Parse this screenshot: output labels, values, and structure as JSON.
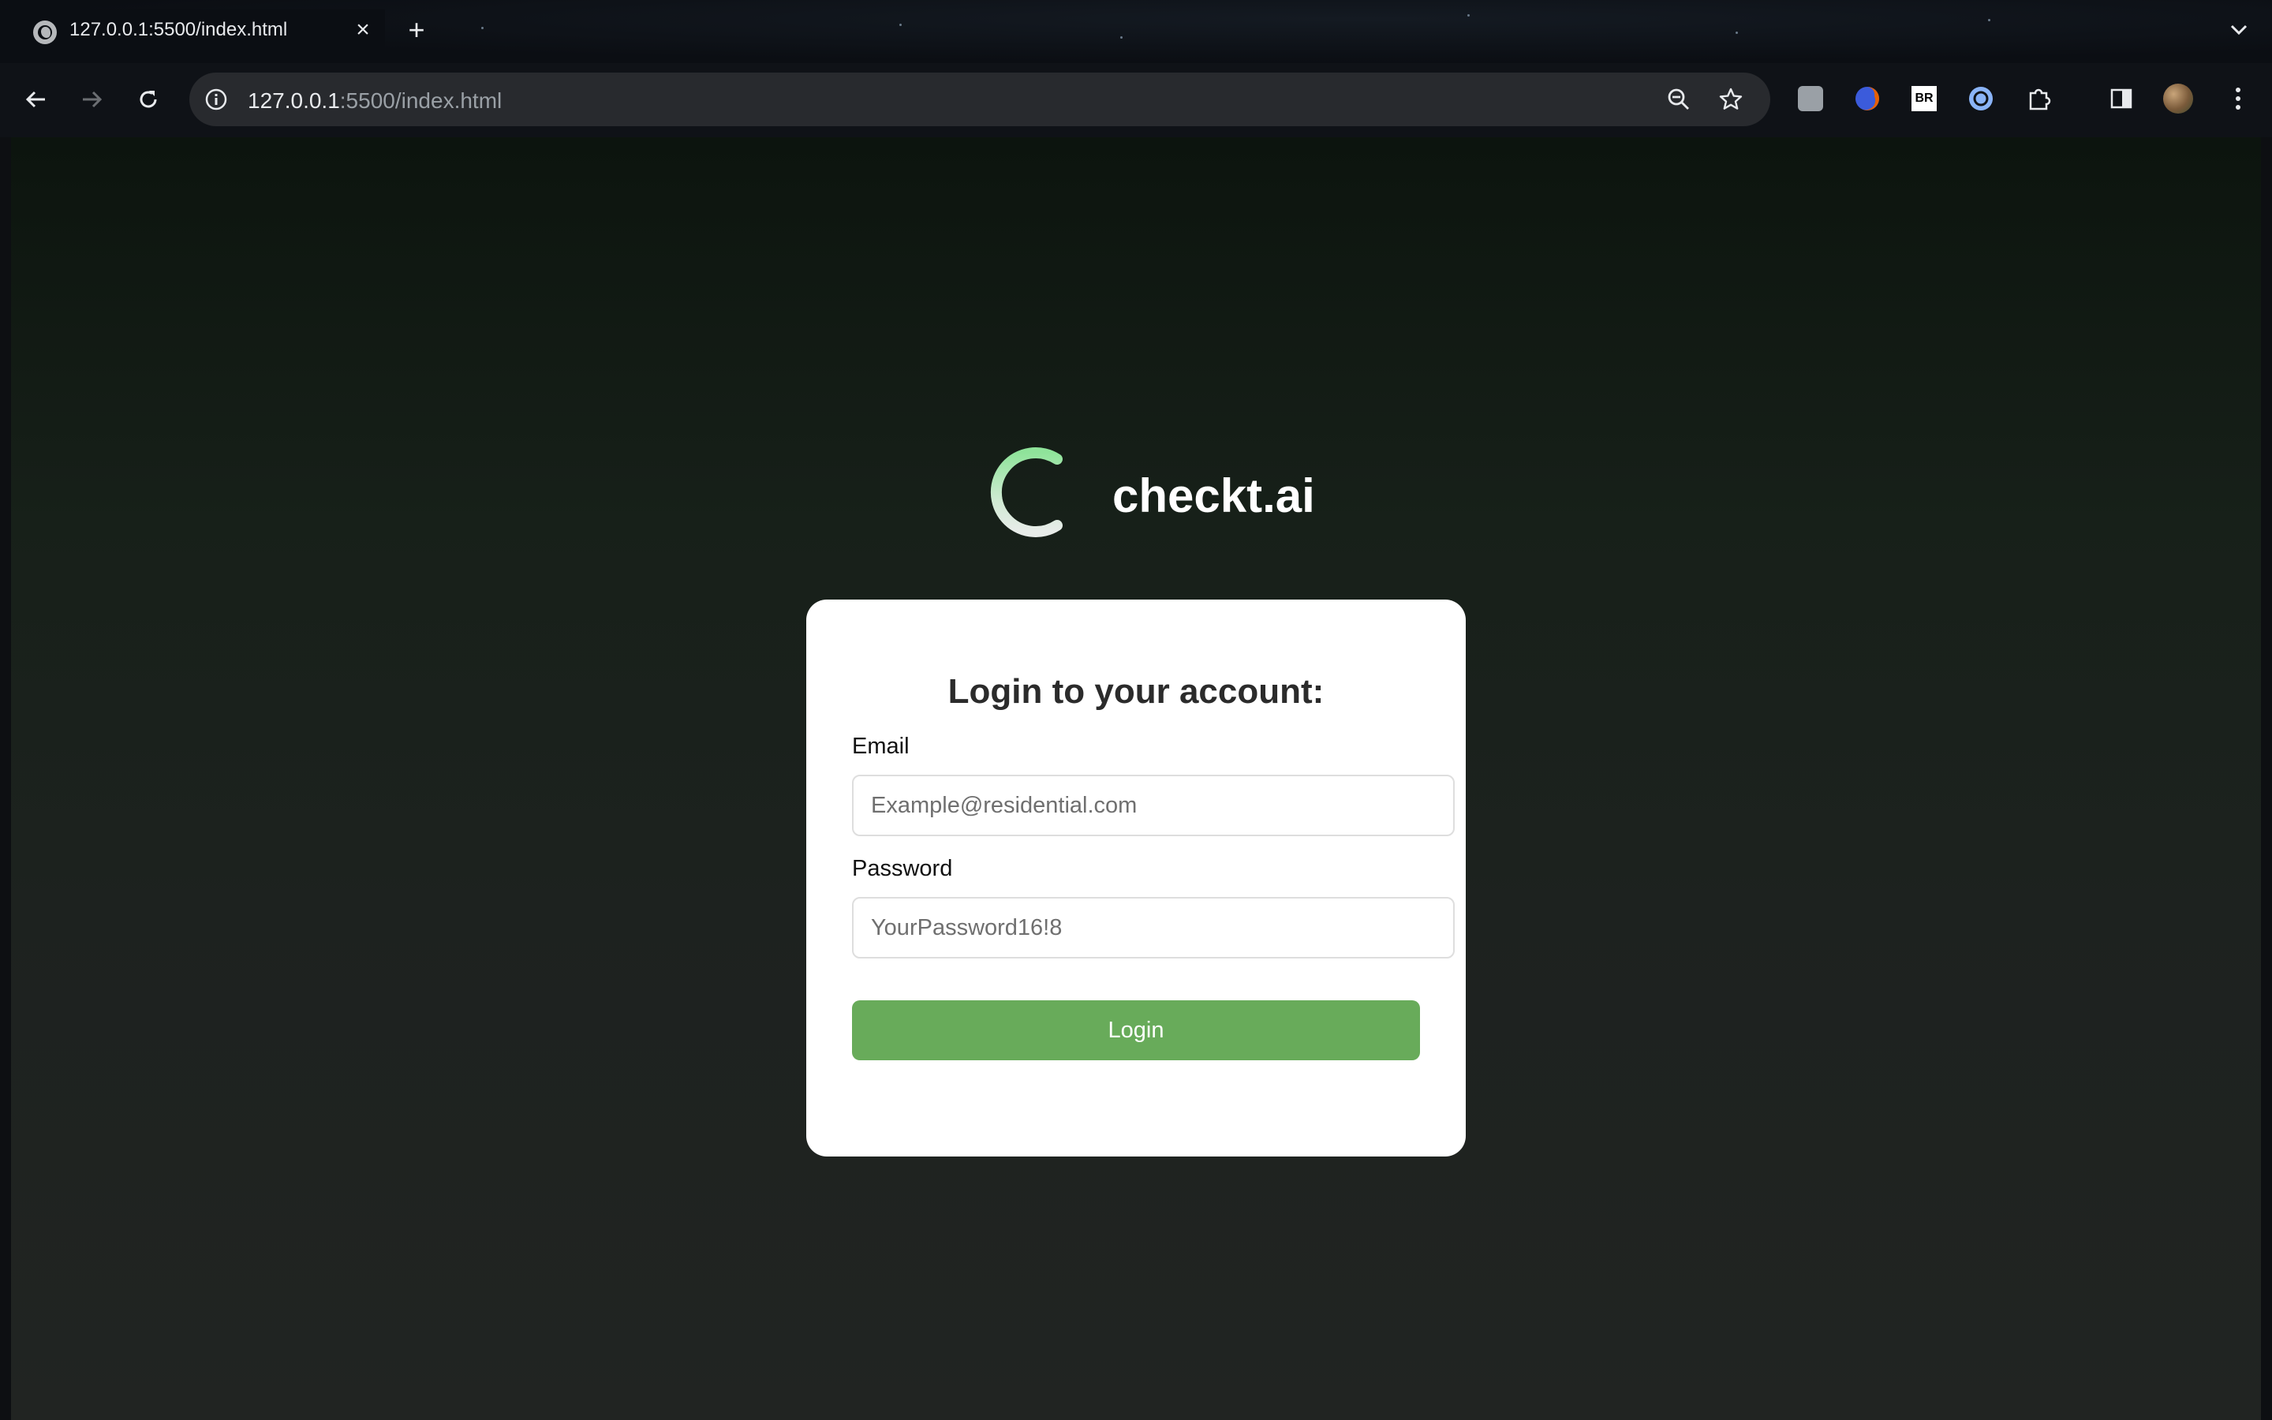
{
  "browser": {
    "tab": {
      "title": "127.0.0.1:5500/index.html"
    },
    "address": {
      "host": "127.0.0.1",
      "path": ":5500/index.html"
    },
    "extensions": [
      {
        "name": "ext-gray-icon",
        "color": "#9aa0a6"
      },
      {
        "name": "ext-firefox-icon",
        "color": "#e66000"
      },
      {
        "name": "ext-br-icon",
        "label": "BR"
      },
      {
        "name": "ext-grammar-icon",
        "color": "#8ab4f8"
      },
      {
        "name": "extensions-puzzle-icon"
      }
    ]
  },
  "brand": {
    "name": "checkt.ai",
    "accent": "#7fd98a"
  },
  "login": {
    "title": "Login to your account:",
    "email_label": "Email",
    "email_placeholder": "Example@residential.com",
    "password_label": "Password",
    "password_placeholder": "YourPassword16!8",
    "button_label": "Login",
    "button_color": "#68ab5a"
  }
}
